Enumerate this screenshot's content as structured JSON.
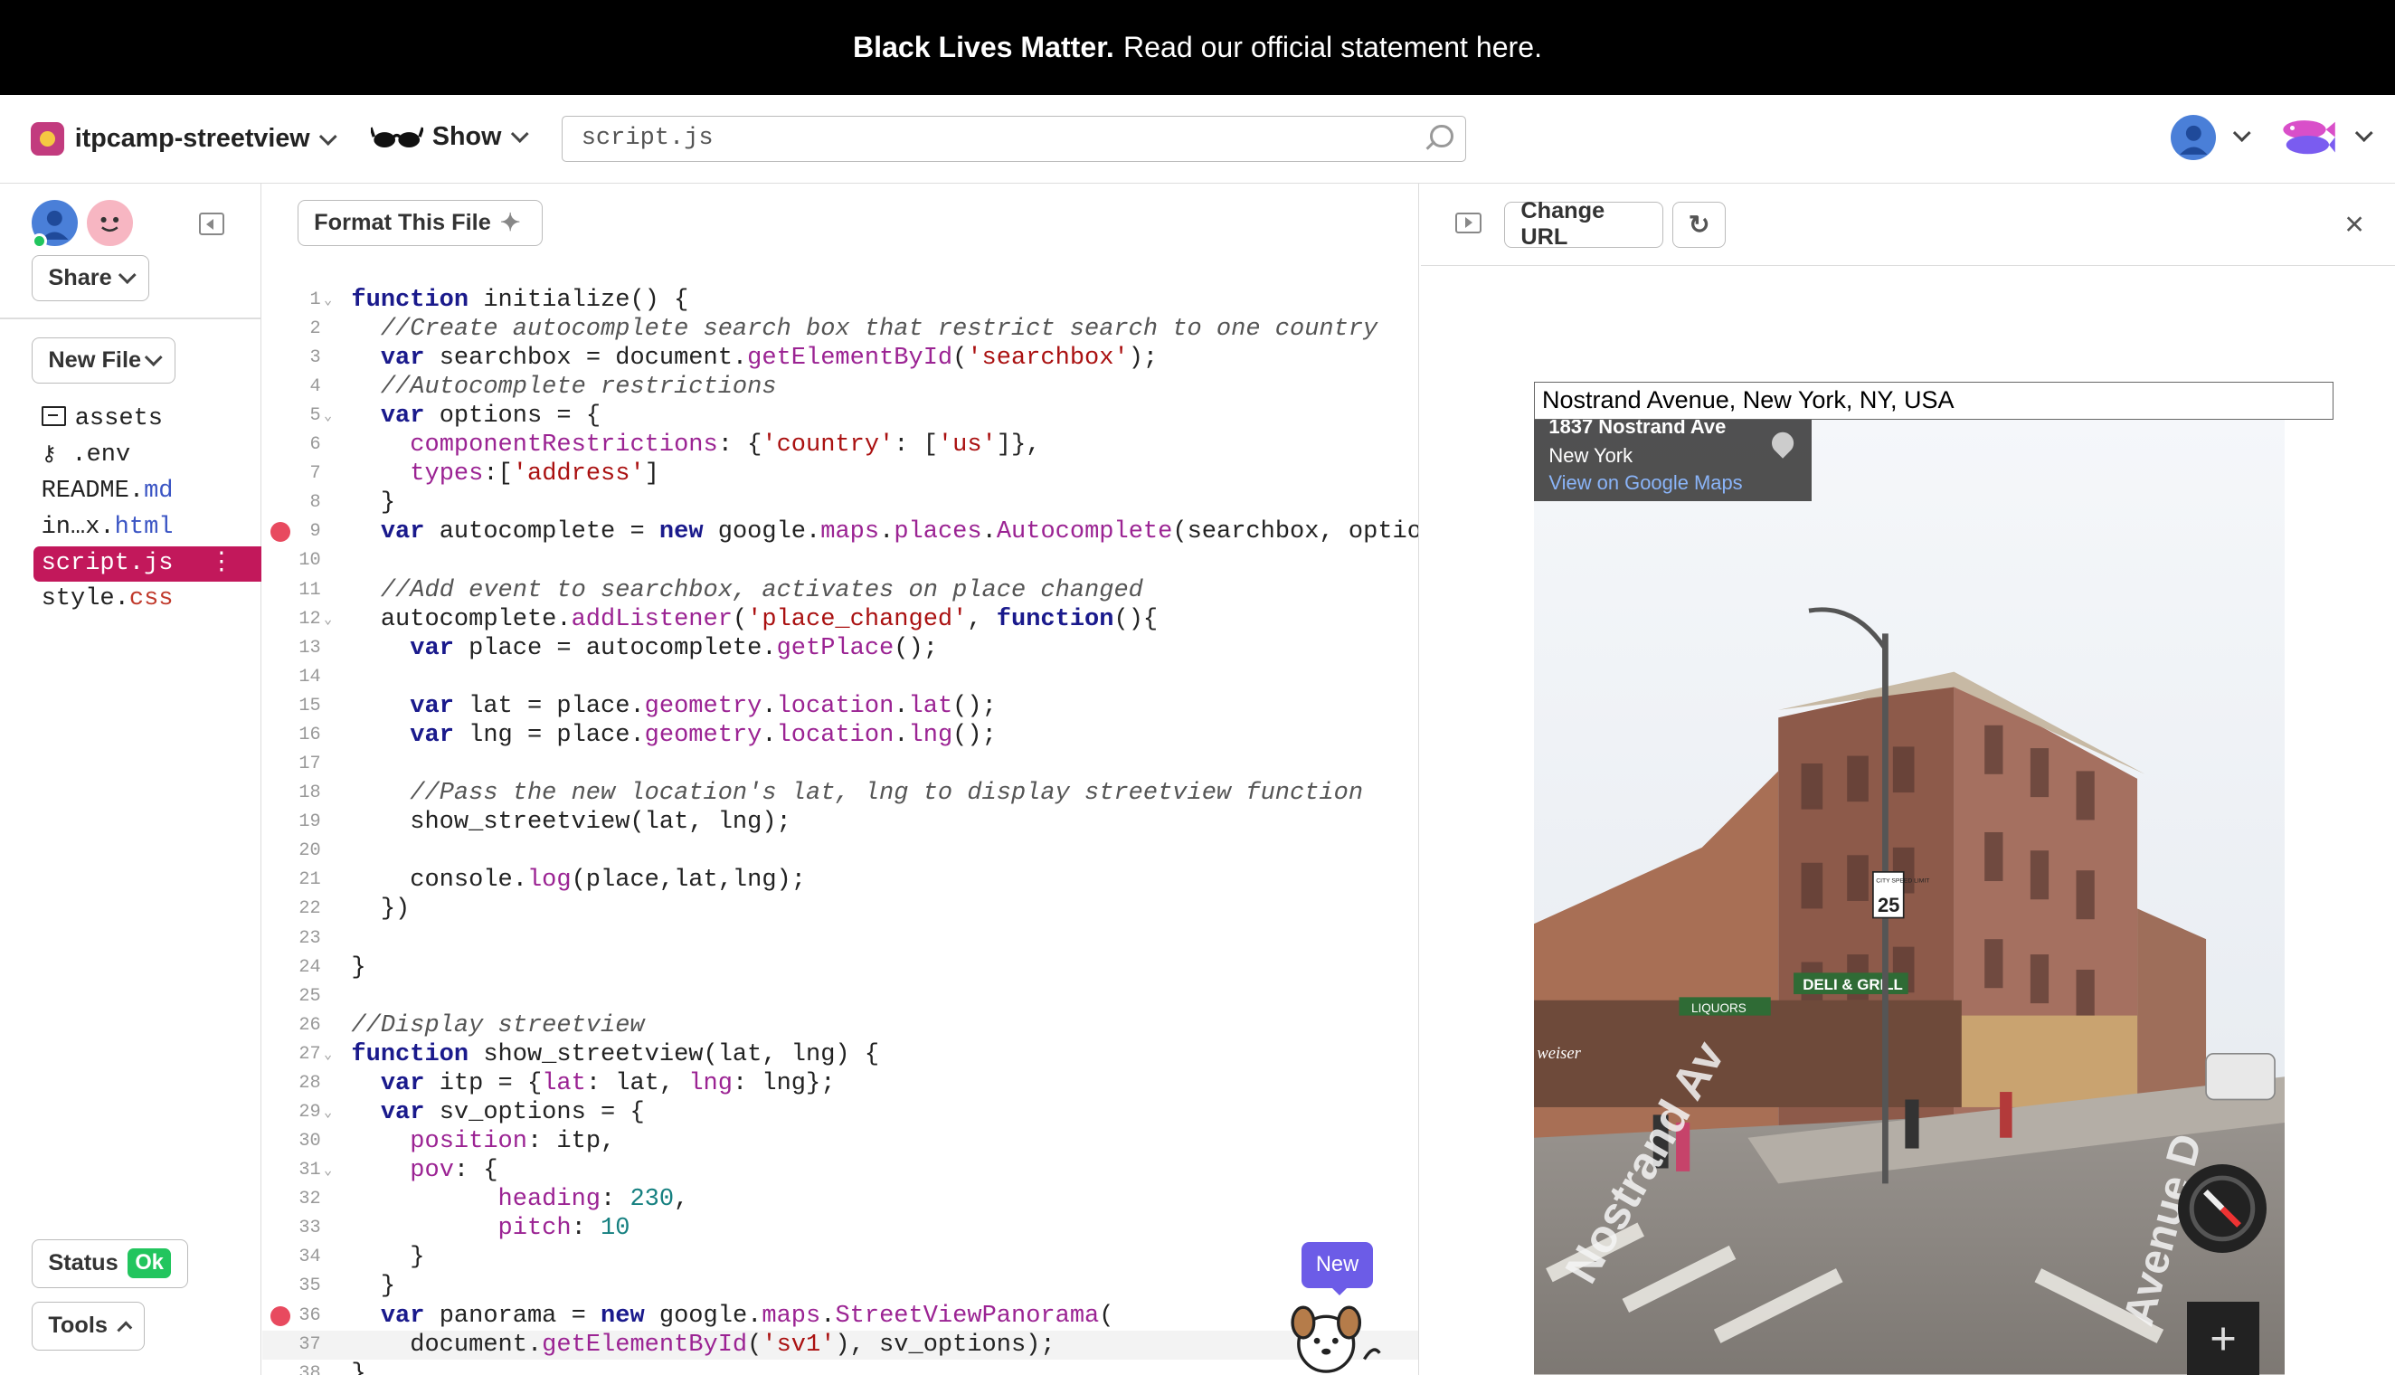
{
  "banner": {
    "bold": "Black Lives Matter.",
    "text": "Read our official statement here."
  },
  "header": {
    "project_name": "itpcamp-streetview",
    "show_label": "Show",
    "search_value": "script.js"
  },
  "sidebar": {
    "share_label": "Share",
    "new_file_label": "New File",
    "files": [
      {
        "name": "assets",
        "ext": ""
      },
      {
        "name": ".env",
        "ext": ""
      },
      {
        "name": "README.",
        "ext": "md"
      },
      {
        "name": "in…x.",
        "ext": "html"
      },
      {
        "name": "script.",
        "ext": "js"
      },
      {
        "name": "style.",
        "ext": "css"
      }
    ],
    "status_label": "Status",
    "status_badge": "Ok",
    "tools_label": "Tools"
  },
  "editor": {
    "format_label": "Format This File",
    "new_badge": "New",
    "line_numbers": [
      "1",
      "2",
      "3",
      "4",
      "5",
      "6",
      "7",
      "8",
      "9",
      "10",
      "11",
      "12",
      "13",
      "14",
      "15",
      "16",
      "17",
      "18",
      "19",
      "20",
      "21",
      "22",
      "23",
      "24",
      "25",
      "26",
      "27",
      "28",
      "29",
      "30",
      "31",
      "32",
      "33",
      "34",
      "35",
      "36",
      "37",
      "38"
    ]
  },
  "preview": {
    "change_url_label": "Change URL",
    "address_value": "Nostrand Avenue, New York, NY, USA",
    "info_title": "1837 Nostrand Ave",
    "info_city": "New York",
    "info_link": "View on Google Maps",
    "speed_sign_top": "CITY SPEED LIMIT",
    "speed_sign_value": "25",
    "street_label_1": "Nostrand Av",
    "street_label_2": "Avenue D",
    "store_sign_1": "DELI & GRILL",
    "store_sign_2": "LIQUORS",
    "store_sign_3": "weiser"
  },
  "colors": {
    "accent": "#c2185b",
    "status_ok": "#22c55e",
    "badge": "#6c5ce7",
    "breakpoint": "#e84a5f"
  }
}
